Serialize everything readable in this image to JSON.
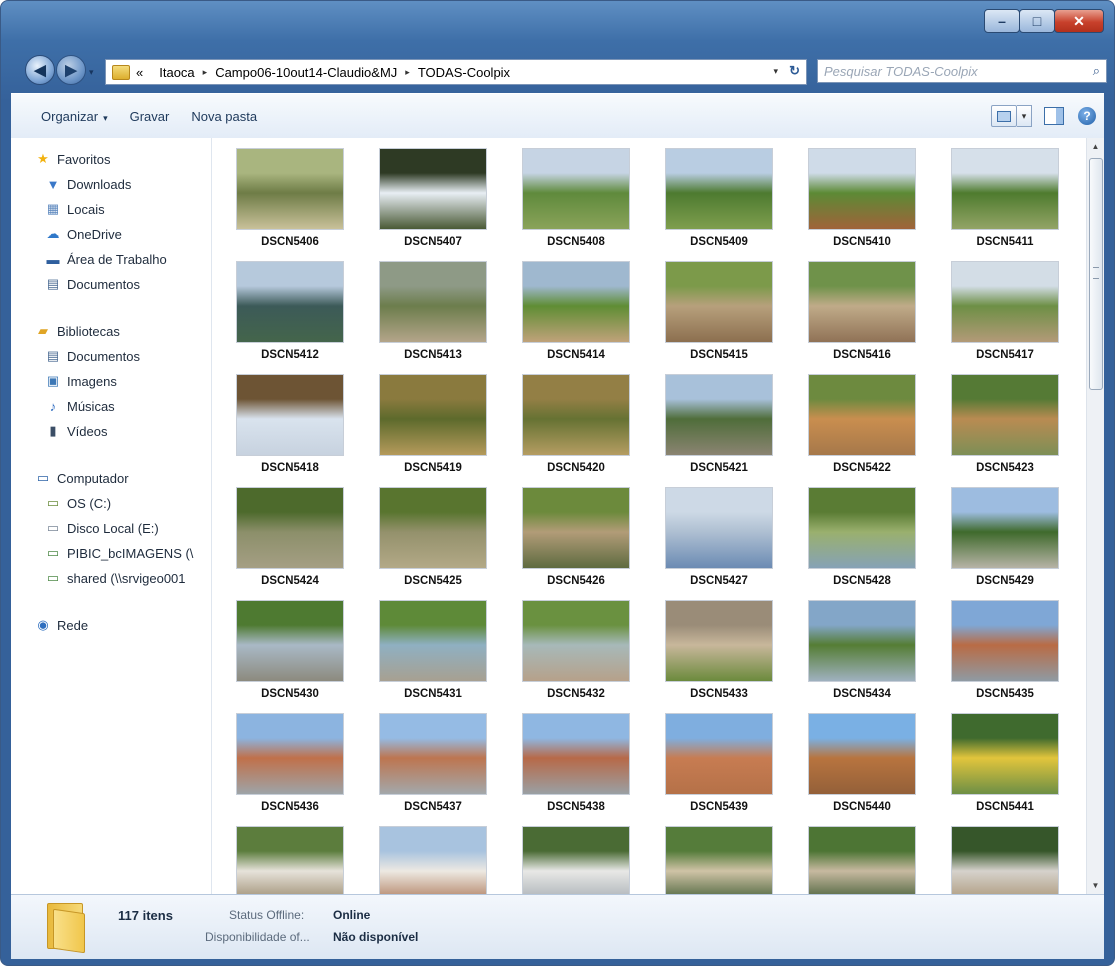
{
  "window": {
    "controls": {
      "minimize": "–",
      "maximize": "□",
      "close": "✕"
    }
  },
  "nav": {
    "back_glyph": "◀",
    "forward_glyph": "▶",
    "recent_glyph": "▾",
    "breadcrumb_prefix": "«",
    "breadcrumbs": [
      "Itaoca",
      "Campo06-10out14-Claudio&MJ",
      "TODAS-Coolpix"
    ],
    "separator": "▸",
    "dropdown_glyph": "▾",
    "refresh_glyph": "↻",
    "search_placeholder": "Pesquisar TODAS-Coolpix",
    "search_glyph": "⌕"
  },
  "toolbar": {
    "organize": "Organizar",
    "organize_caret": "▾",
    "burn": "Gravar",
    "new_folder": "Nova pasta",
    "view_caret": "▾",
    "help": "?"
  },
  "navpane": {
    "items": [
      {
        "label": "Favoritos",
        "icon": "star-icon",
        "level": 0
      },
      {
        "label": "Downloads",
        "icon": "downloads-folder-icon",
        "level": 1
      },
      {
        "label": "Locais",
        "icon": "places-icon",
        "level": 1
      },
      {
        "label": "OneDrive",
        "icon": "cloud-icon",
        "level": 1
      },
      {
        "label": "Área de Trabalho",
        "icon": "desktop-icon",
        "level": 1
      },
      {
        "label": "Documentos",
        "icon": "document-icon",
        "level": 1
      },
      {
        "label": "Bibliotecas",
        "icon": "libraries-icon",
        "level": 0
      },
      {
        "label": "Documentos",
        "icon": "document-icon",
        "level": 1
      },
      {
        "label": "Imagens",
        "icon": "pictures-icon",
        "level": 1
      },
      {
        "label": "Músicas",
        "icon": "music-icon",
        "level": 1
      },
      {
        "label": "Vídeos",
        "icon": "video-icon",
        "level": 1
      },
      {
        "label": "Computador",
        "icon": "computer-icon",
        "level": 0
      },
      {
        "label": "OS (C:)",
        "icon": "system-drive-icon",
        "level": 1
      },
      {
        "label": "Disco Local (E:)",
        "icon": "drive-icon",
        "level": 1
      },
      {
        "label": "PIBIC_bcIMAGENS (\\",
        "icon": "network-drive-icon",
        "level": 1
      },
      {
        "label": "shared (\\\\srvigeo001",
        "icon": "network-drive-icon",
        "level": 1
      },
      {
        "label": "Rede",
        "icon": "network-icon",
        "level": 0
      }
    ]
  },
  "files": [
    {
      "name": "DSCN5406",
      "c": [
        "#a9b57f",
        "#6e7c46",
        "#c9c19a"
      ]
    },
    {
      "name": "DSCN5407",
      "c": [
        "#2e3a24",
        "#e8eef4",
        "#4a5a36"
      ]
    },
    {
      "name": "DSCN5408",
      "c": [
        "#c6d4e4",
        "#5f8a3c",
        "#8aa35a"
      ]
    },
    {
      "name": "DSCN5409",
      "c": [
        "#b9cde2",
        "#4d7a30",
        "#7f9e4e"
      ]
    },
    {
      "name": "DSCN5410",
      "c": [
        "#cfdbe8",
        "#5c8a35",
        "#a0633a"
      ]
    },
    {
      "name": "DSCN5411",
      "c": [
        "#d6e0ea",
        "#4e7b2e",
        "#93a466"
      ]
    },
    {
      "name": "DSCN5412",
      "c": [
        "#b6c9dc",
        "#3c5a58",
        "#44654b"
      ]
    },
    {
      "name": "DSCN5413",
      "c": [
        "#8e9a86",
        "#6c7d4c",
        "#b4a58a"
      ]
    },
    {
      "name": "DSCN5414",
      "c": [
        "#9fb8cf",
        "#5f8d34",
        "#c0a27a"
      ]
    },
    {
      "name": "DSCN5415",
      "c": [
        "#7c9a4a",
        "#b7a07c",
        "#8c6f4f"
      ]
    },
    {
      "name": "DSCN5416",
      "c": [
        "#6f924a",
        "#c0ab89",
        "#907256"
      ]
    },
    {
      "name": "DSCN5417",
      "c": [
        "#d3dde6",
        "#6d8f45",
        "#b39a78"
      ]
    },
    {
      "name": "DSCN5418",
      "c": [
        "#6d5434",
        "#d9e3ee",
        "#c7d2df"
      ]
    },
    {
      "name": "DSCN5419",
      "c": [
        "#8a7a3e",
        "#5d6a2c",
        "#b59a5b"
      ]
    },
    {
      "name": "DSCN5420",
      "c": [
        "#937f45",
        "#667233",
        "#b59d62"
      ]
    },
    {
      "name": "DSCN5421",
      "c": [
        "#a8c1da",
        "#4f6d3a",
        "#8b8472"
      ]
    },
    {
      "name": "DSCN5422",
      "c": [
        "#6d8a3f",
        "#c98e4f",
        "#a6784a"
      ]
    },
    {
      "name": "DSCN5423",
      "c": [
        "#557a35",
        "#b98b52",
        "#7d8f56"
      ]
    },
    {
      "name": "DSCN5424",
      "c": [
        "#4d6a2c",
        "#8c8f6a",
        "#a59f84"
      ]
    },
    {
      "name": "DSCN5425",
      "c": [
        "#59752f",
        "#94916c",
        "#b3a987"
      ]
    },
    {
      "name": "DSCN5426",
      "c": [
        "#6c8a3c",
        "#b29c78",
        "#5e6b40"
      ]
    },
    {
      "name": "DSCN5427",
      "c": [
        "#cdd9e6",
        "#aebfd2",
        "#6b8bb3"
      ]
    },
    {
      "name": "DSCN5428",
      "c": [
        "#5a7c34",
        "#9ab06e",
        "#86a2b6"
      ]
    },
    {
      "name": "DSCN5429",
      "c": [
        "#9dbce0",
        "#3f6a2c",
        "#b7b3a6"
      ]
    },
    {
      "name": "DSCN5430",
      "c": [
        "#4e7a31",
        "#a9b9c6",
        "#8c8a7e"
      ]
    },
    {
      "name": "DSCN5431",
      "c": [
        "#5e8a38",
        "#8fb0c2",
        "#a7a091"
      ]
    },
    {
      "name": "DSCN5432",
      "c": [
        "#6a9140",
        "#a7b9b9",
        "#b6a18a"
      ]
    },
    {
      "name": "DSCN5433",
      "c": [
        "#9a8c78",
        "#c8b79b",
        "#6b8a3c"
      ]
    },
    {
      "name": "DSCN5434",
      "c": [
        "#83a6c8",
        "#557d34",
        "#9fb1bf"
      ]
    },
    {
      "name": "DSCN5435",
      "c": [
        "#7fa7d6",
        "#b96b45",
        "#8f9aa3"
      ]
    },
    {
      "name": "DSCN5436",
      "c": [
        "#8cb4e0",
        "#c0704a",
        "#9ea4a8"
      ]
    },
    {
      "name": "DSCN5437",
      "c": [
        "#95bbe4",
        "#bd7550",
        "#a3a8ab"
      ]
    },
    {
      "name": "DSCN5438",
      "c": [
        "#8fb7e2",
        "#b76948",
        "#9aa0a4"
      ]
    },
    {
      "name": "DSCN5439",
      "c": [
        "#7faedf",
        "#c77c52",
        "#b57148"
      ]
    },
    {
      "name": "DSCN5440",
      "c": [
        "#7ab0e4",
        "#b8743f",
        "#946039"
      ]
    },
    {
      "name": "DSCN5441",
      "c": [
        "#3f6a2e",
        "#e2c53c",
        "#6d8f45"
      ]
    },
    {
      "name": "",
      "c": [
        "#5c7d3d",
        "#e6e2da",
        "#8f7d5d"
      ]
    },
    {
      "name": "",
      "c": [
        "#a8c3df",
        "#ede9e2",
        "#a46b4a"
      ]
    },
    {
      "name": "",
      "c": [
        "#4a6b34",
        "#e8e8e6",
        "#9ea6ad"
      ]
    },
    {
      "name": "",
      "c": [
        "#557c3a",
        "#cfc3a6",
        "#2f4f25"
      ]
    },
    {
      "name": "",
      "c": [
        "#4d7534",
        "#c7b9a0",
        "#2e4d24"
      ]
    },
    {
      "name": "",
      "c": [
        "#36562a",
        "#d6d2cc",
        "#a48d6a"
      ]
    }
  ],
  "status": {
    "count": "117 itens",
    "offline_status_label": "Status Offline:",
    "offline_status_value": "Online",
    "availability_label": "Disponibilidade of...",
    "availability_value": "Não disponível"
  }
}
